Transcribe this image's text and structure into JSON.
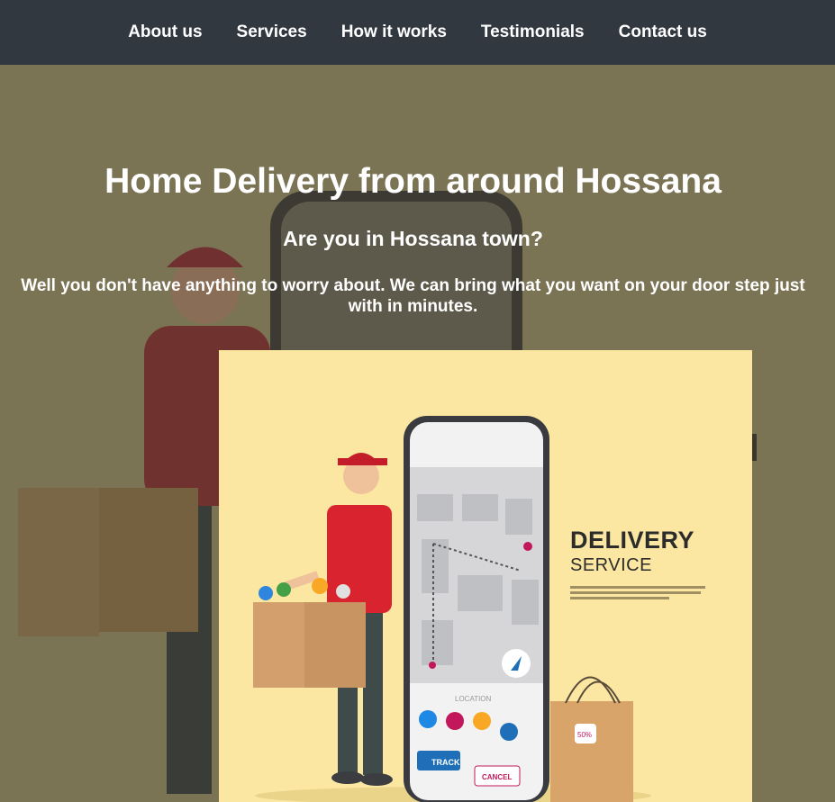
{
  "nav": {
    "items": [
      {
        "label": "About us"
      },
      {
        "label": "Services"
      },
      {
        "label": "How it works"
      },
      {
        "label": "Testimonials"
      },
      {
        "label": "Contact us"
      }
    ]
  },
  "hero": {
    "title": "Home Delivery from around Hossana",
    "subtitle": "Are you in Hossana town?",
    "description": "Well you don't have anything to worry about. We can bring what you want on your door step just with in minutes."
  },
  "illustration": {
    "brand_line1": "DELIVERY",
    "brand_line2": "SERVICE",
    "track_label": "TRACK",
    "cancel_label": "CANCEL",
    "location_label": "LOCATION",
    "tag_label": "50%"
  },
  "colors": {
    "nav_bg": "#323840",
    "hero_overlay": "#7a7354",
    "card_bg": "#fbe7a1",
    "shirt_red": "#d9232e"
  }
}
